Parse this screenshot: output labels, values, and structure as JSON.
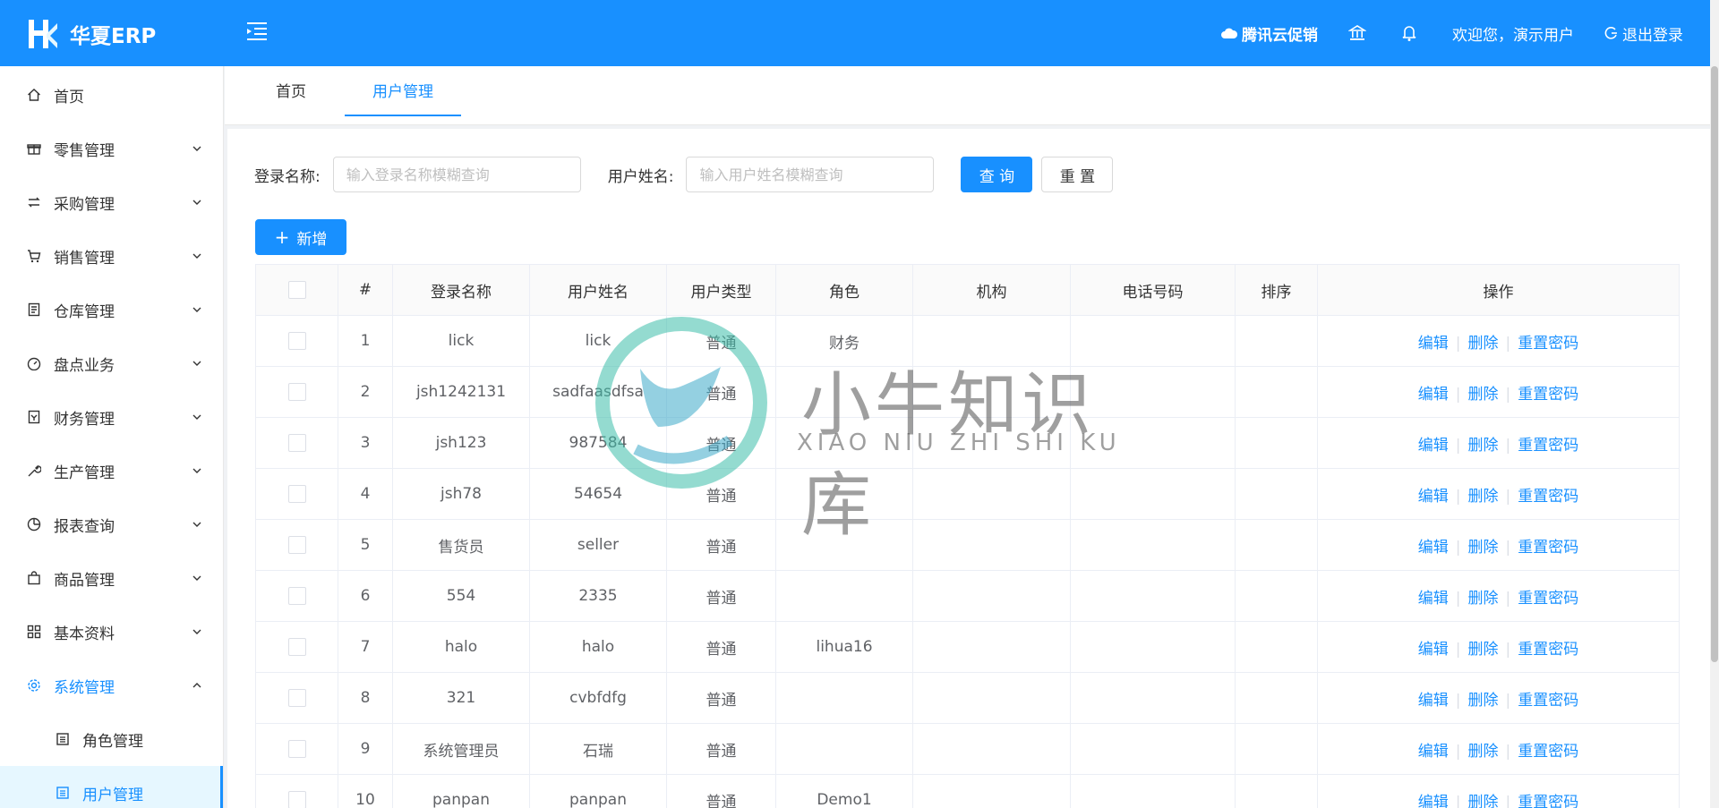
{
  "header": {
    "logo_text": "华夏ERP",
    "promo": "腾讯云促销",
    "welcome": "欢迎您，演示用户",
    "logout": "退出登录"
  },
  "sidebar": {
    "items": [
      {
        "label": "首页",
        "icon": "home-icon"
      },
      {
        "label": "零售管理",
        "icon": "gift-icon"
      },
      {
        "label": "采购管理",
        "icon": "swap-icon"
      },
      {
        "label": "销售管理",
        "icon": "cart-icon"
      },
      {
        "label": "仓库管理",
        "icon": "warehouse-icon"
      },
      {
        "label": "盘点业务",
        "icon": "dashboard-icon"
      },
      {
        "label": "财务管理",
        "icon": "finance-icon"
      },
      {
        "label": "生产管理",
        "icon": "tool-icon"
      },
      {
        "label": "报表查询",
        "icon": "pie-chart-icon"
      },
      {
        "label": "商品管理",
        "icon": "shopping-icon"
      },
      {
        "label": "基本资料",
        "icon": "appstore-icon"
      },
      {
        "label": "系统管理",
        "icon": "setting-icon"
      }
    ],
    "sub_items": [
      {
        "label": "角色管理",
        "icon": "profile-icon"
      },
      {
        "label": "用户管理",
        "icon": "profile-icon"
      }
    ]
  },
  "tabs": [
    {
      "label": "首页"
    },
    {
      "label": "用户管理"
    }
  ],
  "search": {
    "login_label": "登录名称:",
    "login_placeholder": "输入登录名称模糊查询",
    "username_label": "用户姓名:",
    "username_placeholder": "输入用户姓名模糊查询",
    "query_label": "查 询",
    "reset_label": "重 置"
  },
  "toolbar": {
    "add_label": "新增"
  },
  "table": {
    "headers": [
      "#",
      "登录名称",
      "用户姓名",
      "用户类型",
      "角色",
      "机构",
      "电话号码",
      "排序",
      "操作"
    ],
    "actions": {
      "edit": "编辑",
      "delete": "删除",
      "reset_password": "重置密码"
    },
    "rows": [
      {
        "no": "1",
        "login": "lick",
        "name": "lick",
        "type": "普通",
        "role": "财务",
        "org": "",
        "phone": "",
        "sort": ""
      },
      {
        "no": "2",
        "login": "jsh1242131",
        "name": "sadfaasdfsa",
        "type": "普通",
        "role": "",
        "org": "",
        "phone": "",
        "sort": ""
      },
      {
        "no": "3",
        "login": "jsh123",
        "name": "987584",
        "type": "普通",
        "role": "",
        "org": "",
        "phone": "",
        "sort": ""
      },
      {
        "no": "4",
        "login": "jsh78",
        "name": "54654",
        "type": "普通",
        "role": "",
        "org": "",
        "phone": "",
        "sort": ""
      },
      {
        "no": "5",
        "login": "售货员",
        "name": "seller",
        "type": "普通",
        "role": "",
        "org": "",
        "phone": "",
        "sort": ""
      },
      {
        "no": "6",
        "login": "554",
        "name": "2335",
        "type": "普通",
        "role": "",
        "org": "",
        "phone": "",
        "sort": ""
      },
      {
        "no": "7",
        "login": "halo",
        "name": "halo",
        "type": "普通",
        "role": "lihua16",
        "org": "",
        "phone": "",
        "sort": ""
      },
      {
        "no": "8",
        "login": "321",
        "name": "cvbfdfg",
        "type": "普通",
        "role": "",
        "org": "",
        "phone": "",
        "sort": ""
      },
      {
        "no": "9",
        "login": "系统管理员",
        "name": "石瑞",
        "type": "普通",
        "role": "",
        "org": "",
        "phone": "",
        "sort": ""
      },
      {
        "no": "10",
        "login": "panpan",
        "name": "panpan",
        "type": "普通",
        "role": "Demo1",
        "org": "",
        "phone": "",
        "sort": ""
      }
    ]
  },
  "watermark": {
    "cn": "小牛知识库",
    "en": "XIAO NIU ZHI SHI KU"
  },
  "colors": {
    "accent": "#1890ff",
    "header_bg": "#1890ff"
  }
}
